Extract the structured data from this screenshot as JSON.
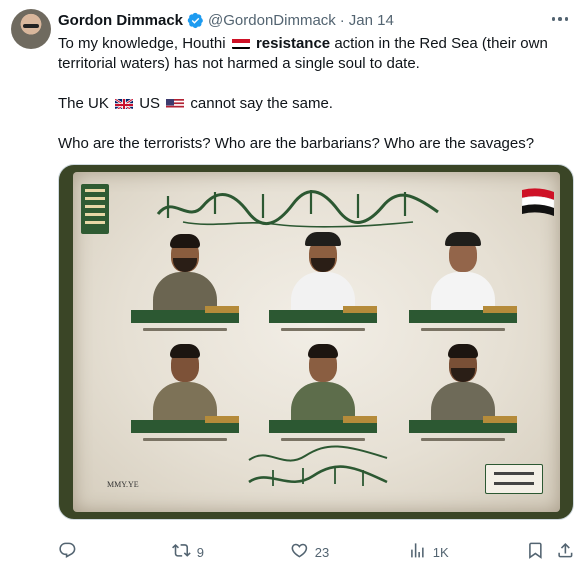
{
  "author": {
    "name": "Gordon Dimmack",
    "handle": "@GordonDimmack",
    "separator": "·",
    "date": "Jan 14"
  },
  "tweet": {
    "line1_before": "To my knowledge, Houthi",
    "line1_bold": "resistance",
    "line1_after": "action in the Red Sea (their own territorial waters) has not harmed a single soul to date.",
    "line2_before": "The UK",
    "line2_mid": "US",
    "line2_after": "cannot say the same.",
    "line3": "Who are the terrorists? Who are the barbarians? Who are the savages?"
  },
  "media": {
    "watermark": "MMY.YE"
  },
  "actions": {
    "reply_count": "",
    "retweet_count": "9",
    "like_count": "23",
    "views_count": "1K"
  },
  "icons": {
    "verified": "verified-badge-icon",
    "more": "more-options-icon",
    "reply": "reply-icon",
    "retweet": "retweet-icon",
    "like": "like-icon",
    "views": "views-icon",
    "bookmark": "bookmark-icon",
    "share": "share-icon"
  },
  "colors": {
    "verified": "#1d9bf0",
    "secondary_text": "#536471",
    "poster_green": "#2c5832"
  }
}
